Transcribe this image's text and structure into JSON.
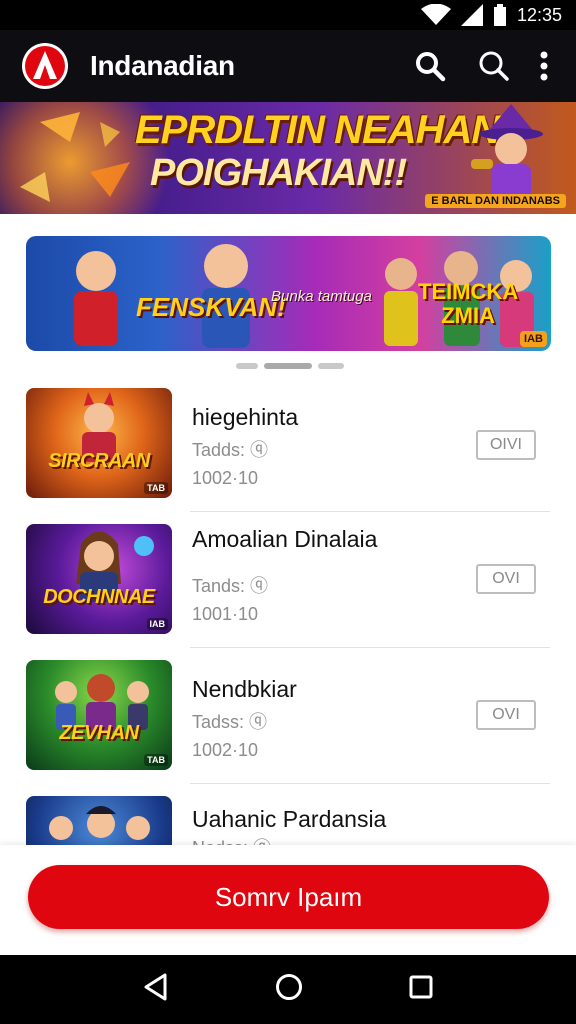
{
  "status_bar": {
    "time": "12:35"
  },
  "app_bar": {
    "title": "Indanadian"
  },
  "hero": {
    "line1": "EPRDLTIN NEAHAN",
    "line2": "POIGHAKIAN!!",
    "caption": "E BARL DAN INDANABS"
  },
  "carousel": {
    "text_a": "FENSKVAN!",
    "text_b": "Bunka tamtuga",
    "text_c_line1": "TEIMCKA",
    "text_c_line2": "ZMIA",
    "badge": "IAB"
  },
  "games": [
    {
      "title": "hiegehinta",
      "meta1": "Tadds: ",
      "meta2": "1002·10",
      "button": "OIVI",
      "thumb_label": "SIRCRAAN",
      "thumb_badge": "TAB"
    },
    {
      "title": "Amoalian Dinalaia",
      "meta1": "Tands: ",
      "meta2": "1001·10",
      "button": "OVI",
      "thumb_label": "DOCHNNAE",
      "thumb_badge": "IAB"
    },
    {
      "title": "Nendbkiar",
      "meta1": "Tadss: ",
      "meta2": "1002·10",
      "button": "OVI",
      "thumb_label": "ZEVHAN",
      "thumb_badge": "TAB"
    },
    {
      "title": "Uahanic Pardansia",
      "meta1": "Nodss: ",
      "meta2": "",
      "button": "",
      "thumb_label": "",
      "thumb_badge": ""
    }
  ],
  "cta": {
    "label": "Somrv Ipaım"
  },
  "colors": {
    "accent": "#e0060f",
    "app_bar": "#0d0d12"
  },
  "icons": [
    "wifi-icon",
    "signal-icon",
    "battery-icon",
    "search-icon",
    "more-vert-icon",
    "back-icon",
    "home-icon",
    "recents-icon"
  ]
}
